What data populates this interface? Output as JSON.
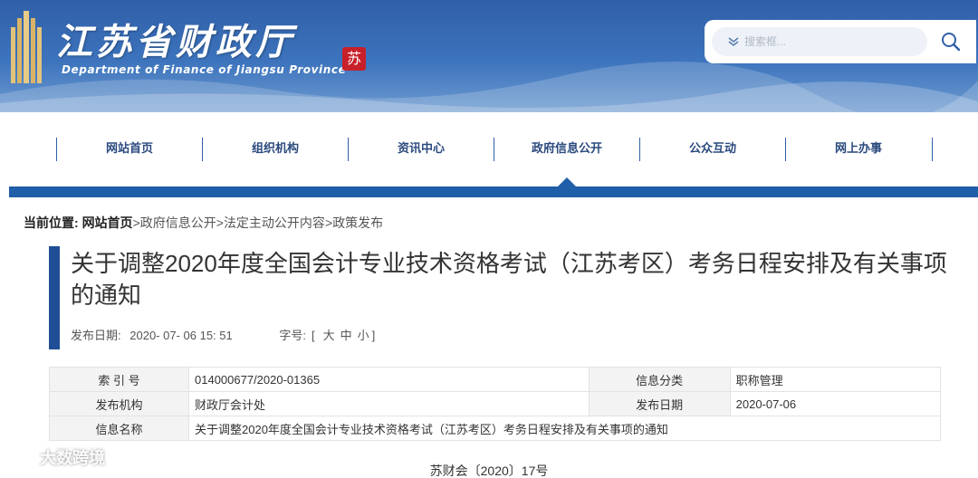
{
  "header": {
    "title": "江苏省财政厅",
    "subtitle": "Department of Finance of Jiangsu Province",
    "seal_text": "苏",
    "search_placeholder": "搜索框..."
  },
  "nav": {
    "items": [
      "网站首页",
      "组织机构",
      "资讯中心",
      "政府信息公开",
      "公众互动",
      "网上办事"
    ],
    "active_index": 3
  },
  "breadcrumb": {
    "prefix": "当前位置:",
    "home": "网站首页",
    "items": [
      "政府信息公开",
      "法定主动公开内容",
      "政策发布"
    ],
    "separator": ">"
  },
  "article": {
    "title": "关于调整2020年度全国会计专业技术资格考试（江苏考区）考务日程安排及有关事项的通知",
    "date_label": "发布日期:",
    "date_value": "2020- 07- 06  15: 51",
    "fontsize_label": "字号:",
    "fontsize_open": "[",
    "fontsize_large": "大",
    "fontsize_medium": "中",
    "fontsize_small": "小",
    "fontsize_close": "]"
  },
  "info_table": {
    "index_label": "索 引 号",
    "index_value": "014000677/2020-01365",
    "category_label": "信息分类",
    "category_value": "职称管理",
    "org_label": "发布机构",
    "org_value": "财政厅会计处",
    "pubdate_label": "发布日期",
    "pubdate_value": "2020-07-06",
    "name_label": "信息名称",
    "name_value": "关于调整2020年度全国会计专业技术资格考试（江苏考区）考务日程安排及有关事项的通知"
  },
  "doc_number": "苏财会〔2020〕17号",
  "watermark": "大数跨境",
  "colors": {
    "brand_blue": "#1f5ea8",
    "title_bar": "#1f4e96",
    "nav_text": "#2b4a7e"
  }
}
